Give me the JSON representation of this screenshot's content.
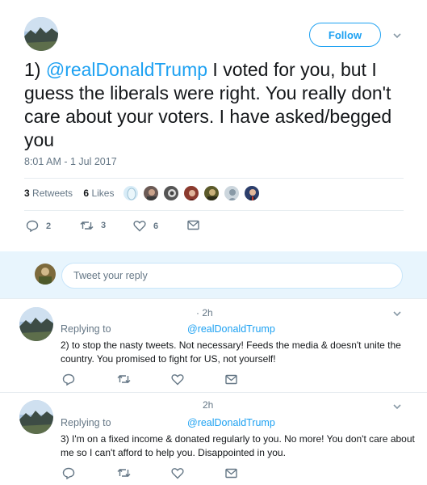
{
  "tweet": {
    "follow_label": "Follow",
    "mention": "@realDonaldTrump",
    "text": " I voted for you, but I guess the liberals were right. You really don't care about your voters. I have asked/begged you",
    "number_prefix": "1) ",
    "timestamp": "8:01 AM - 1 Jul 2017",
    "retweets_count": "3",
    "retweets_label": "Retweets",
    "likes_count": "6",
    "likes_label": "Likes",
    "actions": {
      "reply_count": "2",
      "retweet_count": "3",
      "like_count": "6"
    }
  },
  "reply_box": {
    "placeholder": "Tweet your reply"
  },
  "replies": [
    {
      "time": "· 2h",
      "replying_to_label": "Replying to",
      "mention": "@realDonaldTrump",
      "text": "2) to stop the nasty tweets. Not necessary!  Feeds the media & doesn't unite the country. You promised to fight for US, not yourself!"
    },
    {
      "time": "2h",
      "replying_to_label": "Replying to",
      "mention": "@realDonaldTrump",
      "text": "3) I'm on a fixed income & donated regularly to you. No more!  You don't care about me so I can't afford to help you. Disappointed in you."
    }
  ],
  "colors": {
    "accent": "#1da1f2",
    "muted": "#657786",
    "text": "#14171a",
    "reply_bar": "#e8f5fd"
  }
}
